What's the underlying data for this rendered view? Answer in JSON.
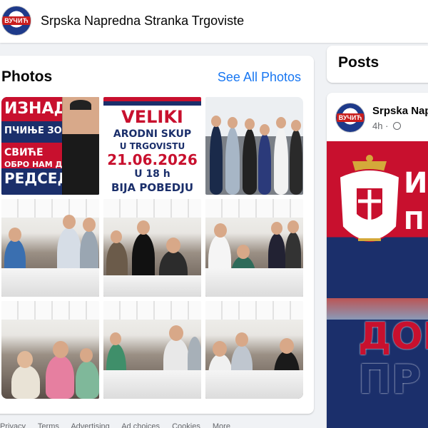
{
  "header": {
    "page_name": "Srpska Napredna Stranka Trgoviste",
    "avatar_text": "ВУЧИЋ"
  },
  "photos": {
    "title": "Photos",
    "see_all": "See All Photos",
    "poster1": {
      "line1": "ИЗНАД",
      "line2": "ПЧИЊЕ ЗОРА",
      "line3": "СВИЋЕ",
      "line3b": "ОБРО НАМ ДОШАО",
      "line4": "РЕДСЕДНИЧ"
    },
    "poster2": {
      "line1": "VELIKI",
      "line2": "ARODNI SKUP",
      "line3": "U TRGOVISTU",
      "line4": "21.06.2026",
      "line5": "U 18 h",
      "line6": "BIJA POBEDJU"
    }
  },
  "posts": {
    "title": "Posts",
    "author": "Srpska Napredna Stranka Trgoviste",
    "time": "4h",
    "image_text": {
      "t1": "И",
      "t2": "П",
      "t3": "",
      "t4": "ДОБ",
      "t5": "ПР"
    }
  },
  "footer": {
    "links": [
      "Privacy",
      "Terms",
      "Advertising",
      "Ad choices",
      "Cookies",
      "More"
    ]
  },
  "colors": {
    "accent": "#1877f2",
    "serbian_red": "#c8102e",
    "serbian_blue": "#1b2f6b"
  }
}
